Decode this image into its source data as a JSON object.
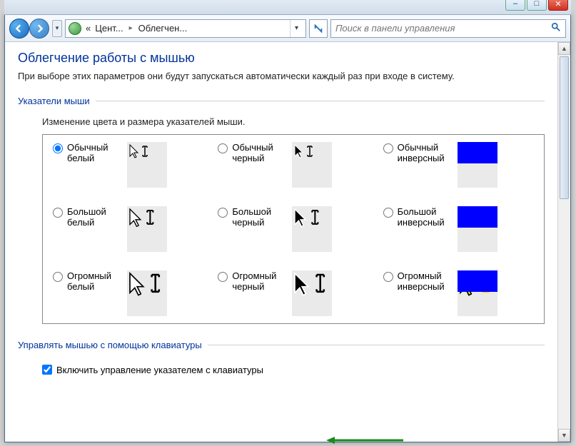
{
  "window_controls": {
    "minimize": "–",
    "maximize": "□",
    "close": "✕"
  },
  "nav": {
    "breadcrumb_prefix": "«",
    "crumb1": "Цент...",
    "crumb2": "Облегчен...",
    "search_placeholder": "Поиск в панели управления"
  },
  "page": {
    "title": "Облегчение работы с мышью",
    "desc": "При выборе этих параметров они будут запускаться автоматически каждый раз при входе в систему."
  },
  "group_pointers": {
    "legend": "Указатели мыши",
    "subdesc": "Изменение цвета и размера указателей мыши.",
    "options": [
      {
        "id": "reg-white",
        "label": "Обычный белый",
        "size": 1,
        "style": "white",
        "checked": true
      },
      {
        "id": "reg-black",
        "label": "Обычный черный",
        "size": 1,
        "style": "black",
        "checked": false
      },
      {
        "id": "reg-inv",
        "label": "Обычный инверсный",
        "size": 1,
        "style": "inverse",
        "checked": false
      },
      {
        "id": "big-white",
        "label": "Большой белый",
        "size": 2,
        "style": "white",
        "checked": false
      },
      {
        "id": "big-black",
        "label": "Большой черный",
        "size": 2,
        "style": "black",
        "checked": false
      },
      {
        "id": "big-inv",
        "label": "Большой инверсный",
        "size": 2,
        "style": "inverse",
        "checked": false
      },
      {
        "id": "huge-white",
        "label": "Огромный белый",
        "size": 3,
        "style": "white",
        "checked": false
      },
      {
        "id": "huge-black",
        "label": "Огромный черный",
        "size": 3,
        "style": "black",
        "checked": false
      },
      {
        "id": "huge-inv",
        "label": "Огромный инверсный",
        "size": 3,
        "style": "inverse",
        "checked": false
      }
    ]
  },
  "group_keyboard": {
    "legend": "Управлять мышью с помощью клавиатуры",
    "checkbox_label": "Включить управление указателем с клавиатуры",
    "checked": true
  }
}
